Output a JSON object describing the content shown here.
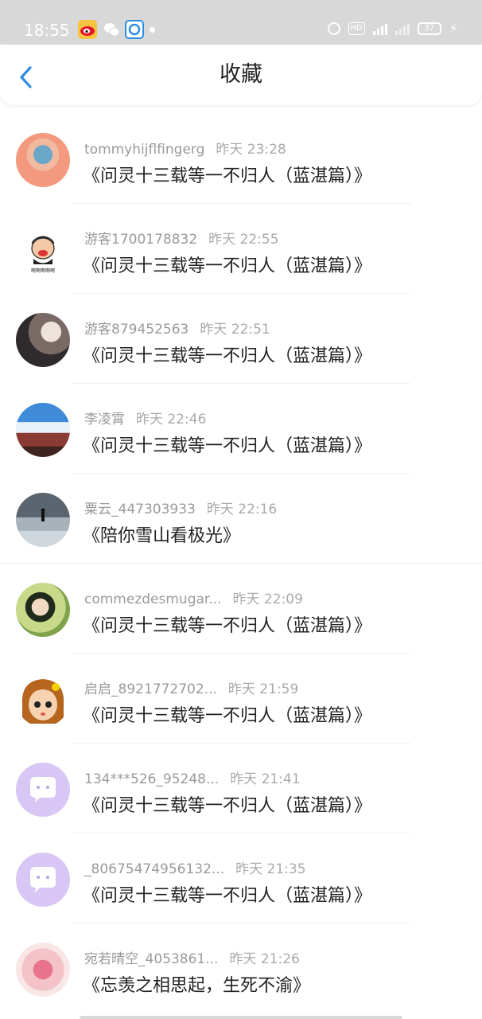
{
  "status_bar": {
    "time": "18:55",
    "battery": "37",
    "hd_label": "HD",
    "icons": [
      "weibo-icon",
      "wechat-icon",
      "app-icon",
      "alarm-icon",
      "hd-icon",
      "4g-signal-icon",
      "signal-icon",
      "battery-icon",
      "charging-icon"
    ]
  },
  "header": {
    "title": "收藏",
    "back_icon": "chevron-left-icon",
    "accent_color": "#2b8de6"
  },
  "items": [
    {
      "user": "tommyhijflfingerg",
      "time": "昨天 23:28",
      "title": "《问灵十三载等一不归人（蓝湛篇）》"
    },
    {
      "user": "游客1700178832",
      "time": "昨天 22:55",
      "title": "《问灵十三载等一不归人（蓝湛篇）》"
    },
    {
      "user": "游客879452563",
      "time": "昨天 22:51",
      "title": "《问灵十三载等一不归人（蓝湛篇）》"
    },
    {
      "user": "李凌霄",
      "time": "昨天 22:46",
      "title": "《问灵十三载等一不归人（蓝湛篇）》"
    },
    {
      "user": "粟云_447303933",
      "time": "昨天 22:16",
      "title": "《陪你雪山看极光》"
    },
    {
      "user": "commezdesmugar...",
      "time": "昨天 22:09",
      "title": "《问灵十三载等一不归人（蓝湛篇）》"
    },
    {
      "user": "启启_8921772702...",
      "time": "昨天 21:59",
      "title": "《问灵十三载等一不归人（蓝湛篇）》"
    },
    {
      "user": "134***526_95248...",
      "time": "昨天 21:41",
      "title": "《问灵十三载等一不归人（蓝湛篇）》"
    },
    {
      "user": "_80675474956132...",
      "time": "昨天 21:35",
      "title": "《问灵十三载等一不归人（蓝湛篇）》"
    },
    {
      "user": "宛若晴空_4053861...",
      "time": "昨天 21:26",
      "title": "《忘羡之相思起，生死不渝》"
    }
  ],
  "avatar_2_caption": "啊啊啊啊啊"
}
